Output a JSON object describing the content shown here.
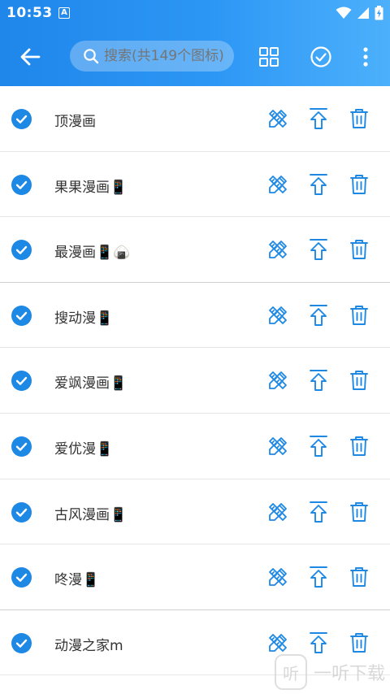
{
  "status_bar": {
    "time": "10:53",
    "notif_letter": "A"
  },
  "toolbar": {
    "search_placeholder": "搜索(共149个图标)"
  },
  "colors": {
    "accent": "#1e88e5",
    "icon_blue": "#1e88e5",
    "text": "#333333"
  },
  "icons": {
    "back": "arrow-left-icon",
    "search": "search-icon",
    "grid": "grid-view-icon",
    "check_all": "check-circle-icon",
    "more": "more-vert-icon",
    "row_check": "checked-circle-icon",
    "edit": "edit-pencil-ruler-icon",
    "pin_top": "arrow-up-to-top-icon",
    "delete": "trash-icon"
  },
  "items": [
    {
      "name": "顶漫画"
    },
    {
      "name": "果果漫画📱"
    },
    {
      "name": "最漫画📱🍙"
    },
    {
      "name": "搜动漫📱"
    },
    {
      "name": "爱飒漫画📱"
    },
    {
      "name": "爱优漫📱"
    },
    {
      "name": "古风漫画📱"
    },
    {
      "name": "咚漫📱"
    },
    {
      "name": "动漫之家m"
    }
  ],
  "watermark": {
    "text": "一听下载",
    "logo": "听"
  }
}
